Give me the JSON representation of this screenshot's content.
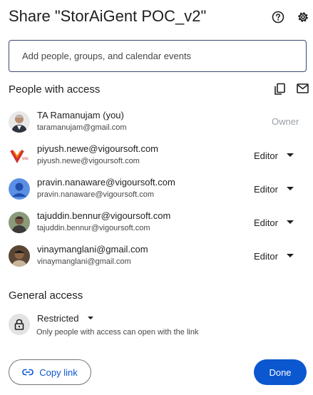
{
  "dialog": {
    "title": "Share \"StorAiGent POC_v2\""
  },
  "header_icons": {
    "help": "help-icon",
    "settings": "gear-icon"
  },
  "add_people": {
    "placeholder": "Add people, groups, and calendar events",
    "value": ""
  },
  "people_section": {
    "title": "People with access",
    "icons": {
      "copy": "copy-emails-icon",
      "email": "email-icon"
    },
    "people": [
      {
        "name": "TA Ramanujam (you)",
        "email": "taramanujam@gmail.com",
        "role": "Owner"
      },
      {
        "name": "piyush.newe@vigoursoft.com",
        "email": "piyush.newe@vigoursoft.com",
        "role": "Editor"
      },
      {
        "name": "pravin.nanaware@vigoursoft.com",
        "email": "pravin.nanaware@vigoursoft.com",
        "role": "Editor"
      },
      {
        "name": "tajuddin.bennur@vigoursoft.com",
        "email": "tajuddin.bennur@vigoursoft.com",
        "role": "Editor"
      },
      {
        "name": "vinaymanglani@gmail.com",
        "email": "vinaymanglani@gmail.com",
        "role": "Editor"
      }
    ]
  },
  "general_access": {
    "title": "General access",
    "level": "Restricted",
    "description": "Only people with access can open with the link",
    "icon": "lock-icon"
  },
  "footer": {
    "copy_link_label": "Copy link",
    "done_label": "Done"
  },
  "colors": {
    "accent": "#0b57d0",
    "text": "#1f1f1f",
    "muted": "#444746"
  }
}
